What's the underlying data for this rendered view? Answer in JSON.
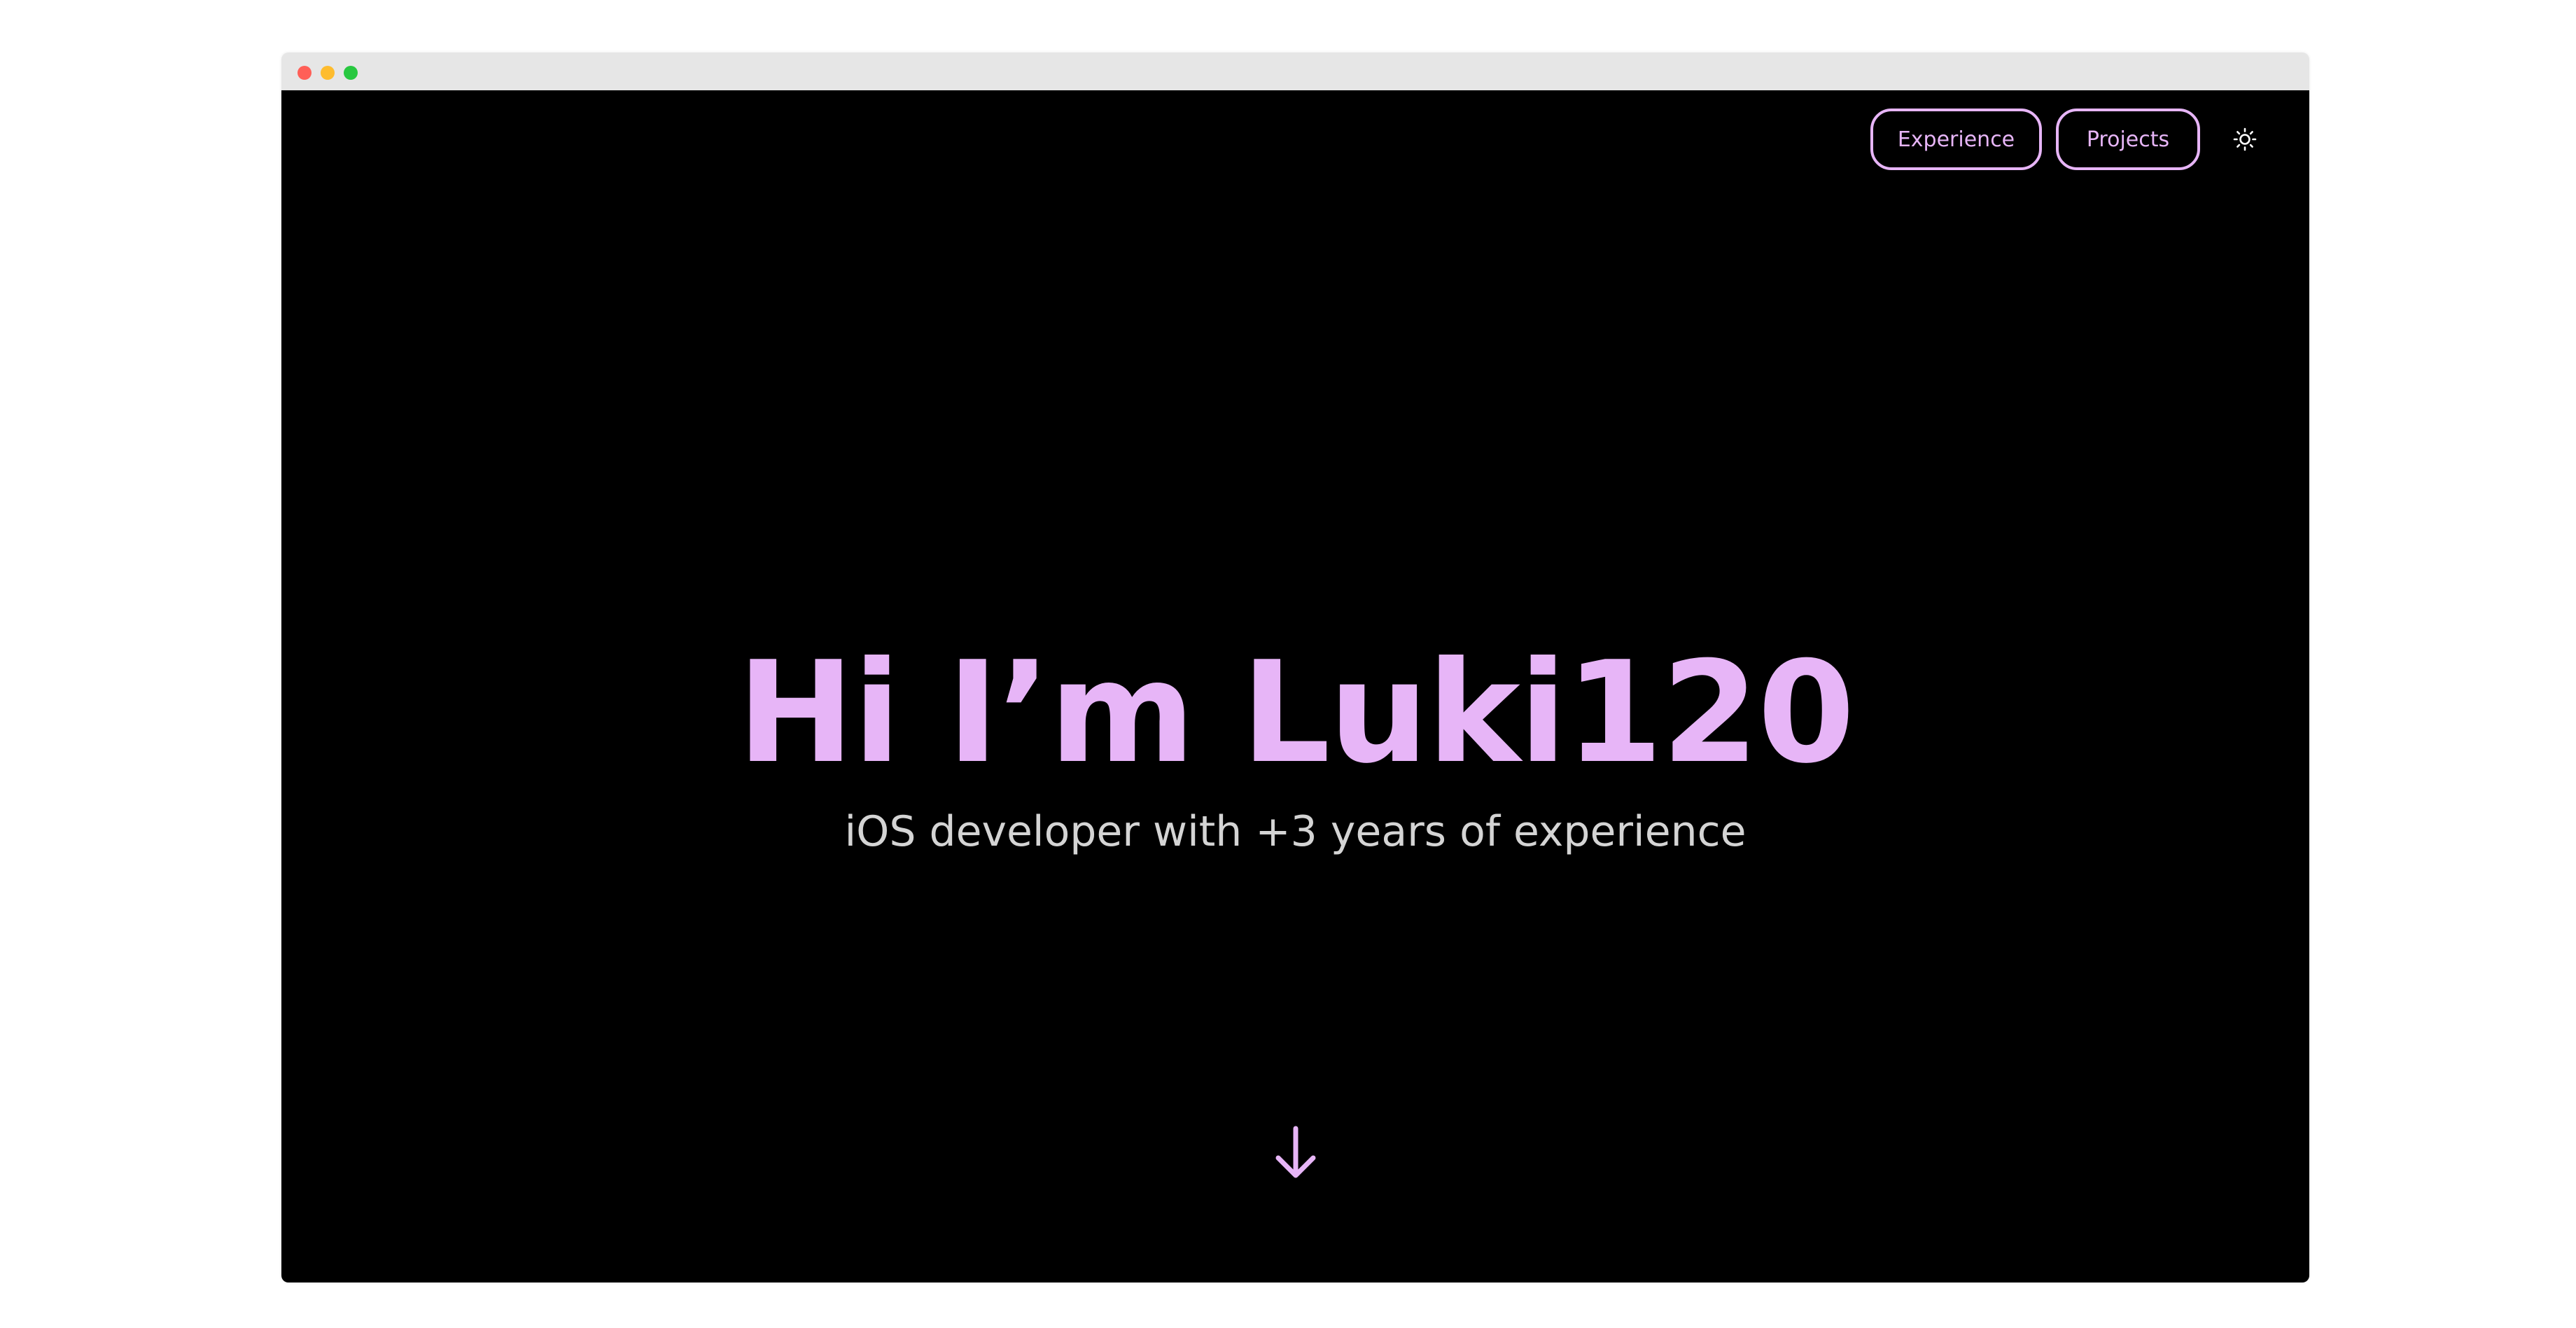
{
  "window": {
    "traffic_lights": {
      "close": "#ff5f57",
      "minimize": "#febc2e",
      "maximize": "#28c840"
    }
  },
  "nav": {
    "experience_label": "Experience",
    "projects_label": "Projects",
    "theme_toggle_icon": "sun-icon"
  },
  "hero": {
    "title": "Hi I’m Luki120",
    "subtitle": "iOS developer with +3 years of experience"
  },
  "scroll_icon": "arrow-down-icon",
  "colors": {
    "background": "#000000",
    "accent": "#e7b5f7",
    "subtitle_text": "#d4d4d4",
    "chrome": "#e6e6e6"
  }
}
